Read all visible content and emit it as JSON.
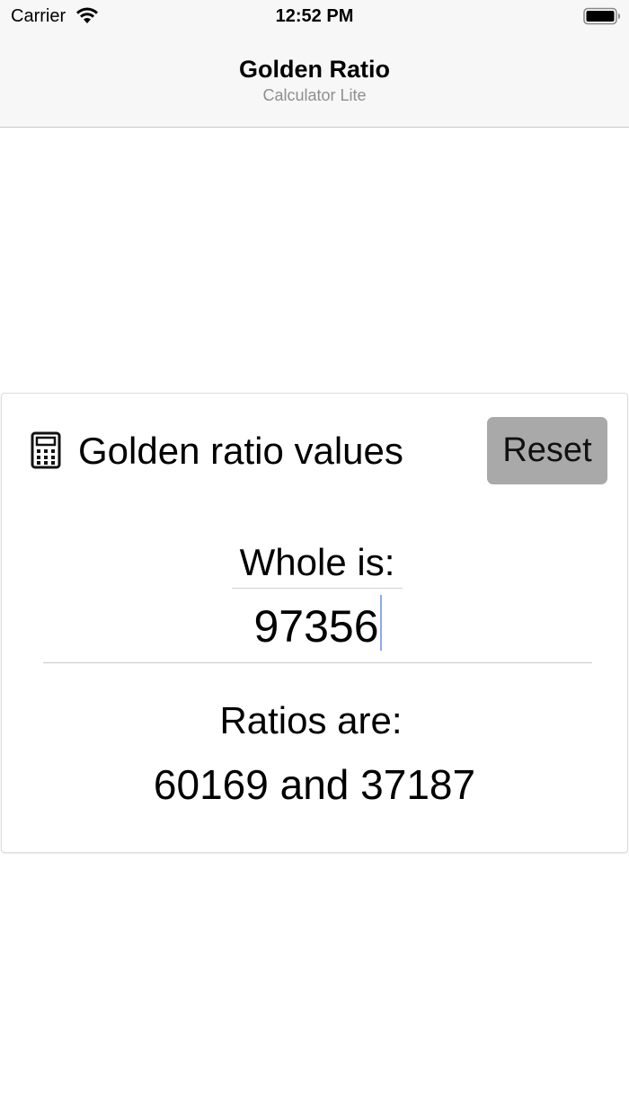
{
  "status_bar": {
    "carrier": "Carrier",
    "time": "12:52 PM",
    "wifi_icon": "wifi-icon",
    "battery_icon": "battery-icon"
  },
  "nav": {
    "title": "Golden Ratio",
    "subtitle": "Calculator Lite"
  },
  "card": {
    "icon": "calculator-icon",
    "title": "Golden ratio values",
    "reset_label": "Reset",
    "whole_label": "Whole is:",
    "whole_value": "97356",
    "ratios_label": "Ratios are:",
    "ratios_value": "60169 and 37187"
  },
  "colors": {
    "nav_background": "#f7f7f7",
    "subtitle": "#8e8e93",
    "reset_button": "#a9a9a9",
    "caret": "#8aa9ee"
  }
}
